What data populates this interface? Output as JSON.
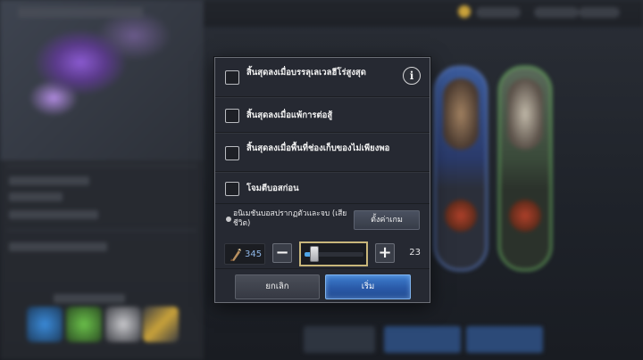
{
  "dialog": {
    "options": [
      {
        "label": "สิ้นสุดลงเมื่อบรรลุเลเวลฮีโร่สูงสุด",
        "checked": false
      },
      {
        "label": "สิ้นสุดลงเมื่อแพ้การต่อสู้",
        "checked": false
      },
      {
        "label": "สิ้นสุดลงเมื่อพื้นที่ช่องเก็บของไม่เพียงพอ",
        "checked": false
      },
      {
        "label": "โจมตีบอสก่อน",
        "checked": false
      }
    ],
    "auto_label": "อนิเมชันบอสปรากฏตัวและจบ (เสียชีวิต)",
    "settings_label": "ตั้งค่าเกม",
    "ticket_count": "345",
    "quantity_max": "23",
    "quantity_level": 0.12,
    "minus_glyph": "−",
    "plus_glyph": "+",
    "info_glyph": "i",
    "cancel_label": "ยกเลิก",
    "start_label": "เริ่ม"
  },
  "icons": {
    "ticket": "stamina-ticket-icon",
    "info": "info-icon"
  },
  "colors": {
    "accent_blue": "#4fa6e8",
    "slider_border": "#c8b67a",
    "start_button": "#2a5aa8"
  }
}
